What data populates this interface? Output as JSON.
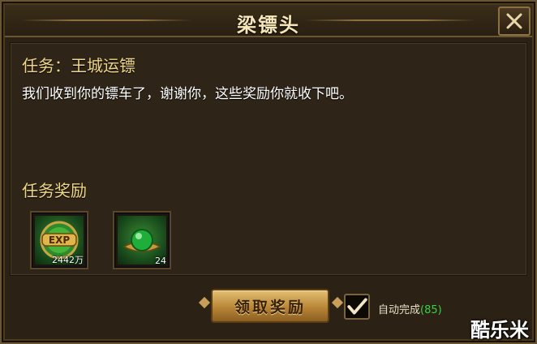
{
  "dialog": {
    "title": "梁镖头",
    "close_icon": "close-x-icon"
  },
  "task": {
    "title": "任务：王城运镖",
    "description": "我们收到你的镖车了，谢谢你，这些奖励你就收下吧。"
  },
  "rewards": {
    "heading": "任务奖励",
    "items": [
      {
        "icon": "exp-icon",
        "quantity": "2442万"
      },
      {
        "icon": "green-orb-icon",
        "quantity": "24"
      }
    ]
  },
  "actions": {
    "claim_label": "领取奖励",
    "auto_complete_checked": true,
    "auto_complete_label": "自动完成",
    "auto_complete_count": "(85)"
  },
  "watermark": "酷乐米",
  "colors": {
    "title_gold": "#f0d689",
    "button_gold": "#c79a4f",
    "count_green": "#38d14a"
  }
}
